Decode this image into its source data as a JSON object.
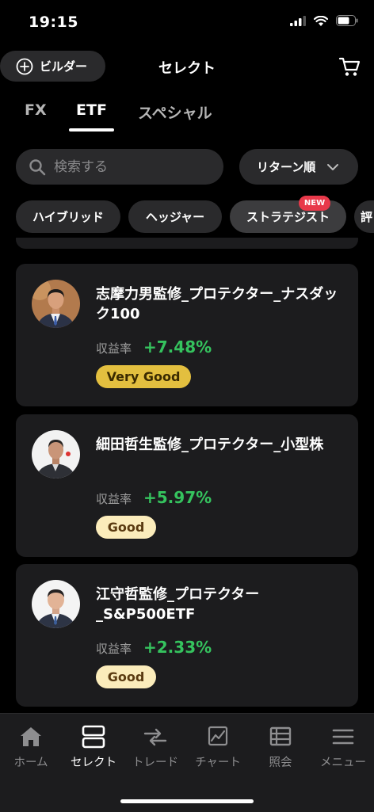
{
  "status_bar": {
    "time": "19:15"
  },
  "header": {
    "builder_label": "ビルダー",
    "title": "セレクト"
  },
  "tabs": [
    {
      "label": "FX"
    },
    {
      "label": "ETF"
    },
    {
      "label": "スペシャル"
    }
  ],
  "search": {
    "placeholder": "検索する"
  },
  "sort": {
    "label": "リターン順"
  },
  "chips": [
    {
      "label": "ハイブリッド"
    },
    {
      "label": "ヘッジャー"
    },
    {
      "label": "ストラテジスト",
      "badge": "NEW"
    },
    {
      "label": "評"
    }
  ],
  "cards": [
    {
      "title": "志摩力男監修_プロテクター_ナスダック100",
      "return_label": "収益率",
      "return_value": "+7.48%",
      "rating": "Very Good"
    },
    {
      "title": "細田哲生監修_プロテクター_小型株",
      "return_label": "収益率",
      "return_value": "+5.97%",
      "rating": "Good"
    },
    {
      "title": "江守哲監修_プロテクター_S&P500ETF",
      "return_label": "収益率",
      "return_value": "+2.33%",
      "rating": "Good"
    }
  ],
  "bottom_nav": [
    {
      "label": "ホーム",
      "icon": "home-icon"
    },
    {
      "label": "セレクト",
      "icon": "select-icon"
    },
    {
      "label": "トレード",
      "icon": "trade-icon"
    },
    {
      "label": "チャート",
      "icon": "chart-icon"
    },
    {
      "label": "照会",
      "icon": "inquiry-icon"
    },
    {
      "label": "メニュー",
      "icon": "menu-icon"
    }
  ],
  "colors": {
    "positive": "#35c35e",
    "very_good_badge": "#e3bf3f",
    "good_badge": "#fbecbb",
    "new_badge": "#e8394a",
    "card_bg": "#1c1c1e"
  }
}
